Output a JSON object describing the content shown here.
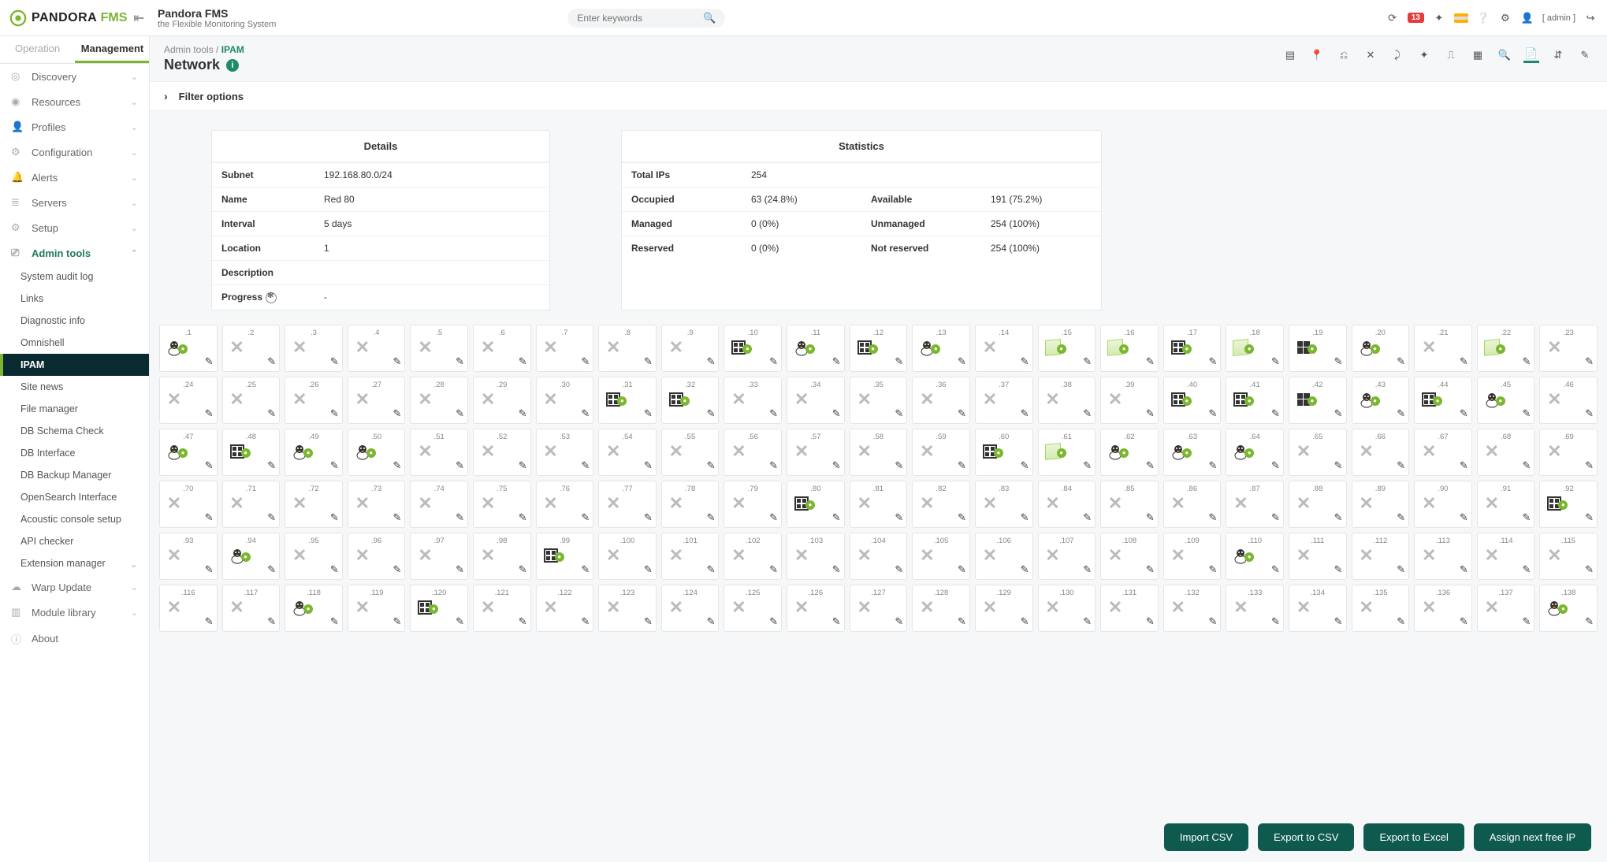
{
  "header": {
    "brand1": "PANDORA",
    "brand2": "FMS",
    "title": "Pandora FMS",
    "subtitle": "the Flexible Monitoring System",
    "search_placeholder": "Enter keywords",
    "notif_count": "13",
    "user": "[ admin ]"
  },
  "tabs": {
    "operation": "Operation",
    "management": "Management"
  },
  "sidebar": {
    "items": [
      {
        "label": "Discovery",
        "chev": true
      },
      {
        "label": "Resources",
        "chev": true
      },
      {
        "label": "Profiles",
        "chev": true
      },
      {
        "label": "Configuration",
        "chev": true
      },
      {
        "label": "Alerts",
        "chev": true
      },
      {
        "label": "Servers",
        "chev": true
      },
      {
        "label": "Setup",
        "chev": true
      }
    ],
    "admin": "Admin tools",
    "admin_sub": [
      "System audit log",
      "Links",
      "Diagnostic info",
      "Omnishell",
      "IPAM",
      "Site news",
      "File manager",
      "DB Schema Check",
      "DB Interface",
      "DB Backup Manager",
      "OpenSearch Interface",
      "Acoustic console setup",
      "API checker",
      "Extension manager"
    ],
    "after": [
      {
        "label": "Warp Update",
        "chev": true
      },
      {
        "label": "Module library",
        "chev": true
      },
      {
        "label": "About",
        "chev": false
      }
    ]
  },
  "breadcrumb": {
    "root": "Admin tools /",
    "cur": "IPAM"
  },
  "page_title": "Network",
  "filter": "Filter options",
  "details": {
    "title": "Details",
    "rows": [
      {
        "k": "Subnet",
        "v": "192.168.80.0/24"
      },
      {
        "k": "Name",
        "v": "Red 80"
      },
      {
        "k": "Interval",
        "v": "5 days"
      },
      {
        "k": "Location",
        "v": "1"
      },
      {
        "k": "Description",
        "v": ""
      },
      {
        "k": "Progress",
        "v": "-"
      }
    ]
  },
  "stats": {
    "title": "Statistics",
    "r1": {
      "k": "Total IPs",
      "v": "254"
    },
    "rows": [
      {
        "k1": "Occupied",
        "v1": "63 (24.8%)",
        "k2": "Available",
        "v2": "191 (75.2%)"
      },
      {
        "k1": "Managed",
        "v1": "0 (0%)",
        "k2": "Unmanaged",
        "v2": "254 (100%)"
      },
      {
        "k1": "Reserved",
        "v1": "0 (0%)",
        "k2": "Not reserved",
        "v2": "254 (100%)"
      }
    ]
  },
  "ips": {
    "1": "tux",
    "2": "x",
    "3": "x",
    "4": "x",
    "5": "x",
    "6": "x",
    "7": "x",
    "8": "x",
    "9": "x",
    "10": "srv",
    "11": "tux",
    "12": "srv",
    "13": "tux",
    "14": "x",
    "15": "cube",
    "16": "cube",
    "17": "srv",
    "18": "cube",
    "19": "win",
    "20": "tux",
    "21": "x",
    "22": "cube",
    "23": "x",
    "24": "x",
    "25": "x",
    "26": "x",
    "27": "x",
    "28": "x",
    "29": "x",
    "30": "x",
    "31": "srv",
    "32": "srv",
    "33": "x",
    "34": "x",
    "35": "x",
    "36": "x",
    "37": "x",
    "38": "x",
    "39": "x",
    "40": "srv",
    "41": "srv",
    "42": "win",
    "43": "tux",
    "44": "srv",
    "45": "tux",
    "46": "x",
    "47": "tux",
    "48": "srv",
    "49": "tux",
    "50": "tux",
    "51": "x",
    "52": "x",
    "53": "x",
    "54": "x",
    "55": "x",
    "56": "x",
    "57": "x",
    "58": "x",
    "59": "x",
    "60": "srv",
    "61": "cube",
    "62": "tux",
    "63": "tux",
    "64": "tux",
    "65": "x",
    "66": "x",
    "67": "x",
    "68": "x",
    "69": "x",
    "70": "x",
    "71": "x",
    "72": "x",
    "73": "x",
    "74": "x",
    "75": "x",
    "76": "x",
    "77": "x",
    "78": "x",
    "79": "x",
    "80": "srv",
    "81": "x",
    "82": "x",
    "83": "x",
    "84": "x",
    "85": "x",
    "86": "x",
    "87": "x",
    "88": "x",
    "89": "x",
    "90": "x",
    "91": "x",
    "92": "srv",
    "93": "x",
    "94": "tux",
    "95": "x",
    "96": "x",
    "97": "x",
    "98": "x",
    "99": "srv",
    "100": "x",
    "101": "x",
    "102": "x",
    "103": "x",
    "104": "x",
    "105": "x",
    "106": "x",
    "107": "x",
    "108": "x",
    "109": "x",
    "110": "tux",
    "111": "x",
    "112": "x",
    "113": "x",
    "114": "x",
    "115": "x",
    "116": "x",
    "117": "x",
    "118": "tux",
    "119": "x",
    "120": "srv",
    "121": "x",
    "122": "x",
    "123": "x",
    "124": "x",
    "125": "x",
    "126": "x",
    "127": "x",
    "128": "x",
    "129": "x",
    "130": "x",
    "131": "x",
    "132": "x",
    "133": "x",
    "134": "x",
    "135": "x",
    "136": "x",
    "137": "x",
    "138": "tux"
  },
  "buttons": {
    "import": "Import CSV",
    "csv": "Export to CSV",
    "excel": "Export to Excel",
    "assign": "Assign next free IP"
  }
}
